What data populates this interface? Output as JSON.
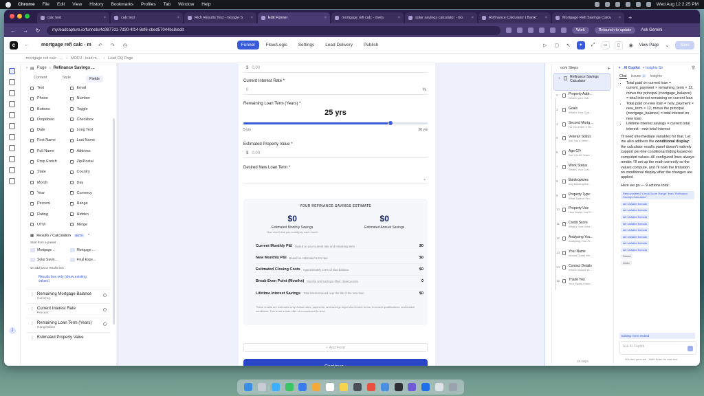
{
  "menubar": {
    "app": "Chrome",
    "items": [
      "File",
      "Edit",
      "View",
      "History",
      "Bookmarks",
      "Profiles",
      "Tab",
      "Window",
      "Help"
    ],
    "clock": "Wed Aug 12  2:25 PM"
  },
  "browser": {
    "tabs": [
      {
        "label": "calc test",
        "active": false
      },
      {
        "label": "calc test",
        "active": false
      },
      {
        "label": "Rich Results Test - Google S",
        "active": false
      },
      {
        "label": "Edit Funnel",
        "active": true
      },
      {
        "label": "mortgage refi calc - meta",
        "active": false
      },
      {
        "label": "solar savings calculator - Go",
        "active": false
      },
      {
        "label": "Refinance Calculator | Bankr",
        "active": false
      },
      {
        "label": "Mortgage Refi Savings Calcu",
        "active": false
      }
    ],
    "url": "my.leadcapture.io/funnels/4c9877d1-7d30-4f14-8ef6-cbed57044bc8/edit",
    "work_label": "Work",
    "relaunch_label": "Relaunch to update",
    "ask_label": "Ask Gemini"
  },
  "app_header": {
    "funnel_title": "mortgage refi calc - m",
    "nav": [
      {
        "label": "Funnel",
        "active": true
      },
      {
        "label": "Flow/Logic",
        "active": false
      },
      {
        "label": "Settings",
        "active": false
      },
      {
        "label": "Lead Delivery",
        "active": false
      },
      {
        "label": "Publish",
        "active": false
      }
    ],
    "view_page": "View Page",
    "save": "Save"
  },
  "breadcrumbs": [
    "mortgage refi calc - ...",
    "MOFU - lead m...",
    "Lead DQ Page"
  ],
  "fields_panel": {
    "page_label": "Page",
    "page_name": "Refinance Savings ...",
    "tabs": [
      {
        "label": "Content"
      },
      {
        "label": "Style"
      },
      {
        "label": "Fields",
        "active": true
      }
    ],
    "fields": [
      "Text",
      "Email",
      "Phone",
      "Number",
      "Buttons",
      "Toggle",
      "Dropdown",
      "Checkbox",
      "Date",
      "Long Text",
      "First Name",
      "Last Name",
      "Full Name",
      "Address",
      "Prop Enrich",
      "Zip/Postal",
      "State",
      "Country",
      "Month",
      "Day",
      "Year",
      "Currency",
      "Percent",
      "Range",
      "Rating",
      "Hidden",
      "UTM",
      "Merge"
    ],
    "results_heading": "Results / Calculation",
    "results_badge": "BETA",
    "preset_note": "Start from a preset",
    "presets": [
      "Mortgage ...",
      "Mortgage ...",
      "Solar Savin...",
      "Final Expe..."
    ],
    "results_box_note": "Or add just a results box",
    "results_link": "Results box only (show existing values)",
    "layers": [
      {
        "name": "Remaining Mortgage Balance",
        "type": "Currency"
      },
      {
        "name": "Current Interest Rate",
        "type": "Percent"
      },
      {
        "name": "Remaining Loan Term (Years)",
        "type": "RangeSlider"
      },
      {
        "name": "Estimated Property Value",
        "type": ""
      }
    ]
  },
  "form": {
    "top_input": "0.00",
    "rate_label": "Current Interest Rate *",
    "rate_placeholder": "0",
    "rate_suffix": "%",
    "term_label": "Remaining Loan Term (Years) *",
    "term_value": "25 yrs",
    "term_min_label": "5 yrs",
    "term_max_label": "30 yrs",
    "term_min": 5,
    "term_max": 30,
    "term_current": 25,
    "prop_label": "Estimated Property Value *",
    "prop_placeholder": "0.00",
    "new_term_label": "Desired New Loan Term *",
    "currency_symbol": "$"
  },
  "estimate": {
    "title": "YOUR REFINANCE SAVINGS ESTIMATE",
    "monthly": {
      "value": "$0",
      "label": "Estimated Monthly Savings",
      "note": "How much less you could pay each month"
    },
    "annual": {
      "value": "$0",
      "label": "Estimated Annual Savings"
    },
    "rows": [
      {
        "name": "Current Monthly P&I",
        "desc": "Based on your current rate and remaining term",
        "value": "$0"
      },
      {
        "name": "New Monthly P&I",
        "desc": "Based on estimated 6.5% rate",
        "value": "$0"
      },
      {
        "name": "Estimated Closing Costs",
        "desc": "Approximately 2.5% of loan balance",
        "value": "$0"
      },
      {
        "name": "Break-Even Point (Months)",
        "desc": "Months until savings offset closing costs",
        "value": "0"
      },
      {
        "name": "Lifetime Interest Savings",
        "desc": "Total interest saved over the life of the new loan",
        "value": "$0"
      }
    ],
    "disclaimer": "These results are estimates only. Actual rates, payments, and savings depend on lender terms, borrower qualifications, and market conditions. This is not a loan offer or commitment to lend."
  },
  "add_field": "+ Add Field",
  "continue_label": "Continue ›",
  "steps": {
    "heading": "ocm Steps",
    "items": [
      {
        "title": "Refinance Savings Calculator",
        "desc": "",
        "active": true
      },
      {
        "title": "Property Addr...",
        "desc": "What's your Sub..."
      },
      {
        "title": "Goals",
        "desc": "What's Your Goa..."
      },
      {
        "title": "Second Mortg...",
        "desc": "Do You Have a Se..."
      },
      {
        "title": "Veteran Status",
        "desc": "Are You a Veter..."
      },
      {
        "title": "Age 62+",
        "desc": "Are You 62 Years ..."
      },
      {
        "title": "Work Status",
        "desc": "What's Your Curr..."
      },
      {
        "title": "Bankruptcies",
        "desc": "Any Bankruptcie..."
      },
      {
        "title": "Property Type",
        "desc": "What Type of Pro..."
      },
      {
        "title": "Property Use",
        "desc": "How Would You D..."
      },
      {
        "title": "Credit Score",
        "desc": "What's Your Cred..."
      },
      {
        "title": "Analyzing You...",
        "desc": "Analyzing Your Pr..."
      },
      {
        "title": "Your Name",
        "desc": "Almost Done! Wh..."
      },
      {
        "title": "Contact Details",
        "desc": "Where Should W..."
      },
      {
        "title": "Thank You",
        "desc": "Your Equity Estim..."
      }
    ],
    "footer": "15 steps"
  },
  "ai": {
    "title": "AI Copilot",
    "insights_btn": "+ Insights Str",
    "tabs": [
      {
        "label": "Chat",
        "active": true
      },
      {
        "label": "Issues",
        "badge": "0"
      },
      {
        "label": "Insights"
      }
    ],
    "bullets": [
      "Total paid on current loan = current_payment × remaining_term × 12, minus the principal (mortgage_balance) = total interest remaining on current loan",
      "Total paid on new loan = new_payment × new_term × 12, minus the principal (mortgage_balance) = total interest on new loan",
      "Lifetime interest savings = current total interest - new total interest"
    ],
    "para1_a": "I'll need intermediate variables for that. Let me also address the ",
    "para1_b": "conditional display",
    "para1_c": ": the calculator results panel doesn't natively support per-line conditional hiding based on computed values. All configured lines always render. I'll set up the math correctly so the values compute, and I'll note the limitation on conditional display after the changes are applied.",
    "para2": "Here we go — 9 actions total:",
    "chips": [
      "Removed field \"Credit Score Range\" from \"Refinance Savings Calculator\"",
      "set variable formula",
      "set variable formula",
      "set variable formula",
      "set variable formula",
      "set variable formula",
      "set variable formula",
      "set variable formula",
      "set variable formula"
    ],
    "status_1": "Saved",
    "status_2": "Undo",
    "editing": "Editing: form embed",
    "input_placeholder": "Ask AI Copilot",
    "footer": "304 free gens left · Shift+Enter for new line"
  }
}
